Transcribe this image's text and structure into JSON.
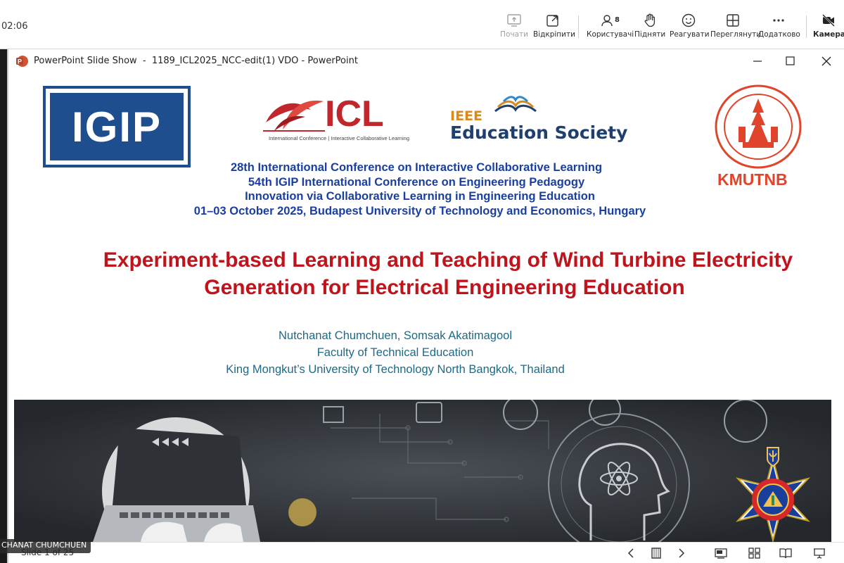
{
  "meeting": {
    "timer": "02:06",
    "toolbar": [
      {
        "key": "share",
        "label": "Почати",
        "disabled": true
      },
      {
        "key": "popout",
        "label": "Відкріпити"
      },
      {
        "key": "people",
        "label": "Користувачі",
        "count": "8"
      },
      {
        "key": "raise",
        "label": "Підняти"
      },
      {
        "key": "react",
        "label": "Реагувати"
      },
      {
        "key": "view",
        "label": "Переглянути"
      },
      {
        "key": "more",
        "label": "Додатково"
      },
      {
        "key": "camera",
        "label": "Камера"
      }
    ],
    "participant_name": "CHANAT CHUMCHUEN"
  },
  "ppt_window": {
    "title": "PowerPoint Slide Show  -  1189_ICL2025_NCC-edit(1) VDO - PowerPoint",
    "slide_counter": "Slide 1 of 25"
  },
  "slide": {
    "logos": {
      "igip": "IGIP",
      "icl": "ICL",
      "icl_subtitle": "International Conference | Interactive Collaborative Learning",
      "ieee": "IEEE",
      "ieee_society": "Education Society",
      "kmutnb": "KMUTNB"
    },
    "conference_lines": [
      "28th International Conference on Interactive Collaborative Learning",
      "54th IGIP International Conference on Engineering Pedagogy",
      "Innovation via Collaborative Learning in Engineering Education",
      "01–03 October 2025, Budapest University of Technology and Economics, Hungary"
    ],
    "title_lines": [
      "Experiment-based Learning and Teaching of Wind Turbine Electricity",
      "Generation for Electrical Engineering Education"
    ],
    "author_lines": [
      "Nutchanat Chumchuen, Somsak  Akatimagool",
      "Faculty of Technical Education",
      "King Mongkut’s University of Technology North Bangkok, Thailand"
    ]
  },
  "colors": {
    "igip_blue": "#1f4e8f",
    "icl_red": "#c0262b",
    "ieee_orange": "#d98a1a",
    "ieee_navy": "#1f3f6d",
    "kmutnb_orange": "#e0452c",
    "conf_blue": "#1a3fa0",
    "title_red": "#c0141c",
    "author_teal": "#1a6a8a"
  }
}
